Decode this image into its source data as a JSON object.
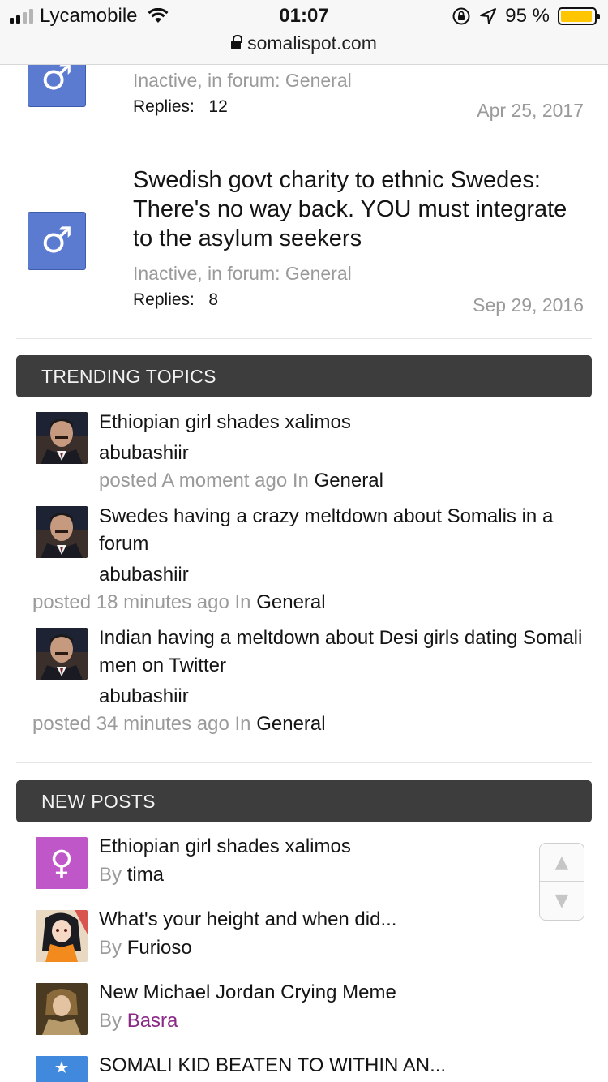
{
  "status_bar": {
    "carrier": "Lycamobile",
    "time": "01:07",
    "battery": "95 %",
    "battery_level": 0.95,
    "url": "somalispot.com"
  },
  "threads": [
    {
      "title": "",
      "meta": "Inactive, in forum: General",
      "replies_label": "Replies:",
      "replies": "12",
      "date": "Apr 25, 2017",
      "avatar_icon": "male-icon"
    },
    {
      "title": "Swedish govt charity to ethnic Swedes: There's no way back. YOU must integrate to the asylum seekers",
      "meta": "Inactive, in forum: General",
      "replies_label": "Replies:",
      "replies": "8",
      "date": "Sep 29, 2016",
      "avatar_icon": "male-icon"
    }
  ],
  "trending": {
    "header": "TRENDING TOPICS",
    "items": [
      {
        "title": "Ethiopian girl shades xalimos",
        "user": "abubashiir",
        "posted": "posted",
        "time": "A moment ago",
        "in": "In",
        "forum": "General"
      },
      {
        "title": "Swedes having a crazy meltdown about Somalis in a forum",
        "user": "abubashiir",
        "posted": "posted",
        "time": "18 minutes ago",
        "in": "In",
        "forum": "General"
      },
      {
        "title": "Indian having a meltdown about Desi girls dating Somali men on Twitter",
        "user": "abubashiir",
        "posted": "posted",
        "time": "34 minutes ago",
        "in": "In",
        "forum": "General"
      }
    ]
  },
  "new_posts": {
    "header": "NEW POSTS",
    "by": "By",
    "items": [
      {
        "title": "Ethiopian girl shades xalimos",
        "user": "tima",
        "avatar": "female-icon"
      },
      {
        "title": "What's your height and when did...",
        "user": "Furioso",
        "avatar": "anime-avatar"
      },
      {
        "title": "New Michael Jordan Crying Meme",
        "user": "Basra",
        "avatar": "portrait-avatar"
      },
      {
        "title": "SOMALI KID BEATEN TO WITHIN AN...",
        "user": "",
        "avatar": "somali-flag-avatar"
      }
    ]
  },
  "colors": {
    "header_bg": "#3d3d3d",
    "male_avatar": "#5b7bd1",
    "female_avatar": "#c057c9",
    "muted_text": "#9a9a9a",
    "battery": "#ffc600",
    "special_user": "#8a2a86"
  },
  "icons": {
    "scroll_up": "triangle-up-icon",
    "scroll_down": "triangle-down-icon"
  }
}
